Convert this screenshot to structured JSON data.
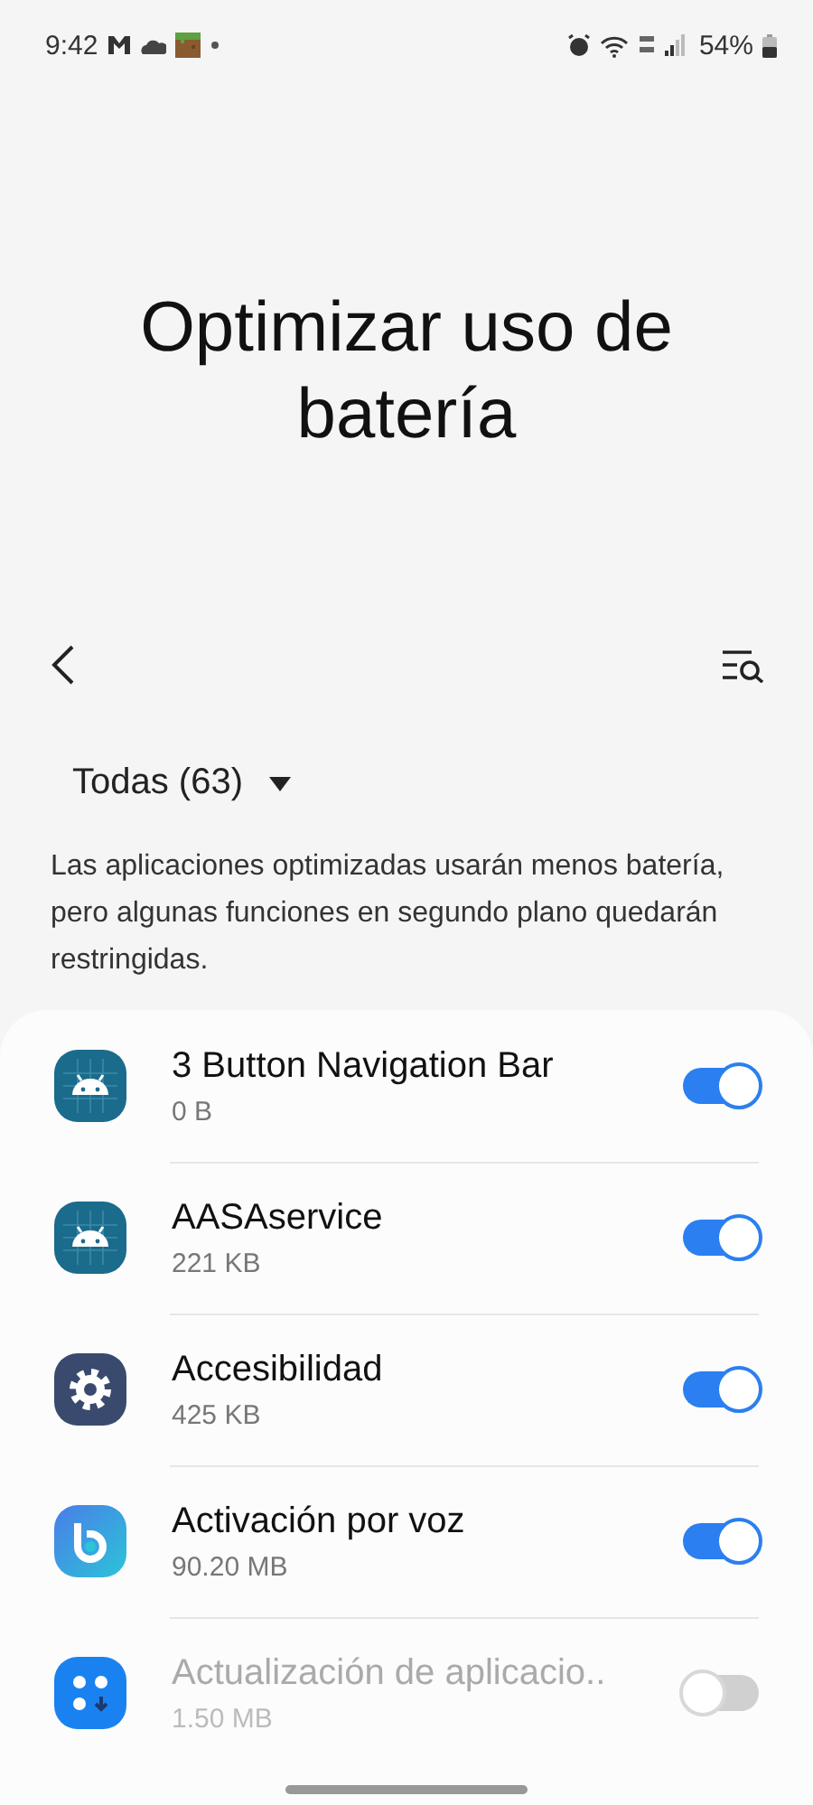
{
  "status_bar": {
    "time": "9:42",
    "battery": "54%"
  },
  "title": "Optimizar uso de batería",
  "filter": {
    "label": "Todas (63)"
  },
  "description": "Las aplicaciones optimizadas usarán menos batería, pero algunas funciones en segundo plano quedarán restringidas.",
  "apps": [
    {
      "name": "3 Button Navigation Bar",
      "size": "0 B",
      "kind": "android",
      "on": true,
      "disabled": false
    },
    {
      "name": "AASAservice",
      "size": "221 KB",
      "kind": "android",
      "on": true,
      "disabled": false
    },
    {
      "name": "Accesibilidad",
      "size": "425 KB",
      "kind": "settings",
      "on": true,
      "disabled": false
    },
    {
      "name": "Activación por voz",
      "size": "90.20 MB",
      "kind": "voice",
      "on": true,
      "disabled": false
    },
    {
      "name": "Actualización de aplicacio..",
      "size": "1.50 MB",
      "kind": "update",
      "on": false,
      "disabled": true
    }
  ]
}
